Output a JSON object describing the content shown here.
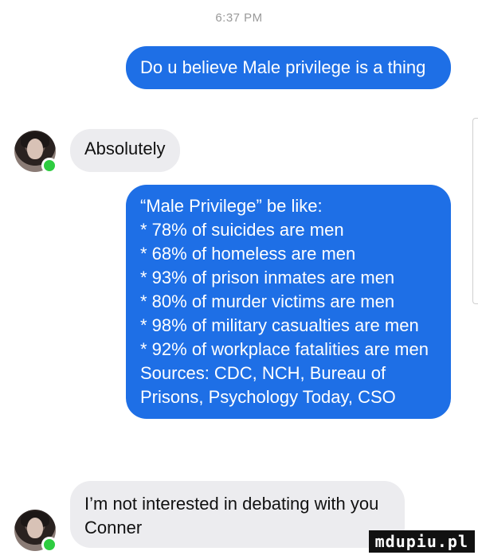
{
  "status_time": "6:37 PM",
  "messages": {
    "m1": "Do u believe Male privilege is a thing",
    "m2": "Absolutely",
    "m3": {
      "intro": "“Male Privilege” be like:",
      "stats": [
        "* 78% of suicides are men",
        "* 68% of homeless are men",
        "* 93% of prison inmates are men",
        "* 80% of murder victims are men",
        "* 98% of military casualties are men",
        "* 92% of workplace fatalities are men"
      ],
      "sources": "Sources: CDC, NCH, Bureau of Prisons, Psychology Today, CSO"
    },
    "m4": "I’m not interested in debating with you Conner"
  },
  "watermark": "mdupiu.pl",
  "colors": {
    "outgoing_bubble": "#1e6fe6",
    "incoming_bubble": "#ececef",
    "online_dot": "#2ecc40"
  }
}
